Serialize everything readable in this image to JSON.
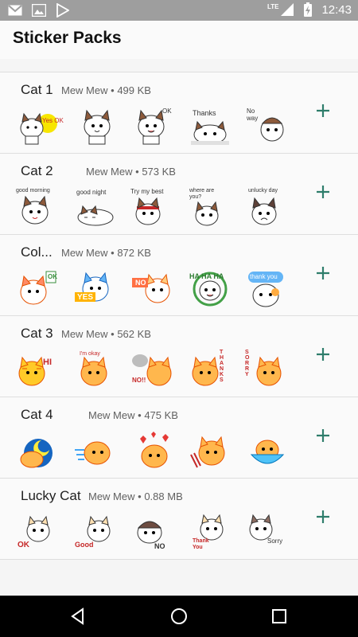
{
  "status_bar": {
    "time": "12:43",
    "network": "LTE"
  },
  "app_bar": {
    "title": "Sticker Packs"
  },
  "packs": [
    {
      "name": "Cat 1",
      "publisher": "Mew Mew",
      "size": "499 KB",
      "stickers": [
        "Yes OK",
        "",
        "OK",
        "Thanks",
        "No way"
      ]
    },
    {
      "name": "Cat 2",
      "publisher": "Mew Mew",
      "size": "573 KB",
      "stickers": [
        "good morning",
        "good night",
        "Try my best",
        "where are you?",
        "unlucky day"
      ]
    },
    {
      "name": "Col...",
      "publisher": "Mew Mew",
      "size": "872 KB",
      "stickers": [
        "OK",
        "YES",
        "NO",
        "HA HA HA",
        "thank you"
      ]
    },
    {
      "name": "Cat 3",
      "publisher": "Mew Mew",
      "size": "562 KB",
      "stickers": [
        "HI",
        "I'm okay",
        "NO!!",
        "THANKS",
        "SORRY"
      ]
    },
    {
      "name": "Cat 4",
      "publisher": "Mew Mew",
      "size": "475 KB",
      "stickers": [
        "",
        "",
        "",
        "",
        ""
      ]
    },
    {
      "name": "Lucky Cat",
      "publisher": "Mew Mew",
      "size": "0.88 MB",
      "stickers": [
        "OK",
        "Good",
        "NO",
        "Thank You",
        "Sorry"
      ]
    }
  ],
  "separator": "•",
  "icons": {
    "add": "plus-icon",
    "back": "back-triangle-icon",
    "home": "home-circle-icon",
    "recents": "recents-square-icon"
  },
  "colors": {
    "accent": "#2e7d6b",
    "status_bar": "#9e9e9e",
    "nav_bar": "#000000"
  }
}
